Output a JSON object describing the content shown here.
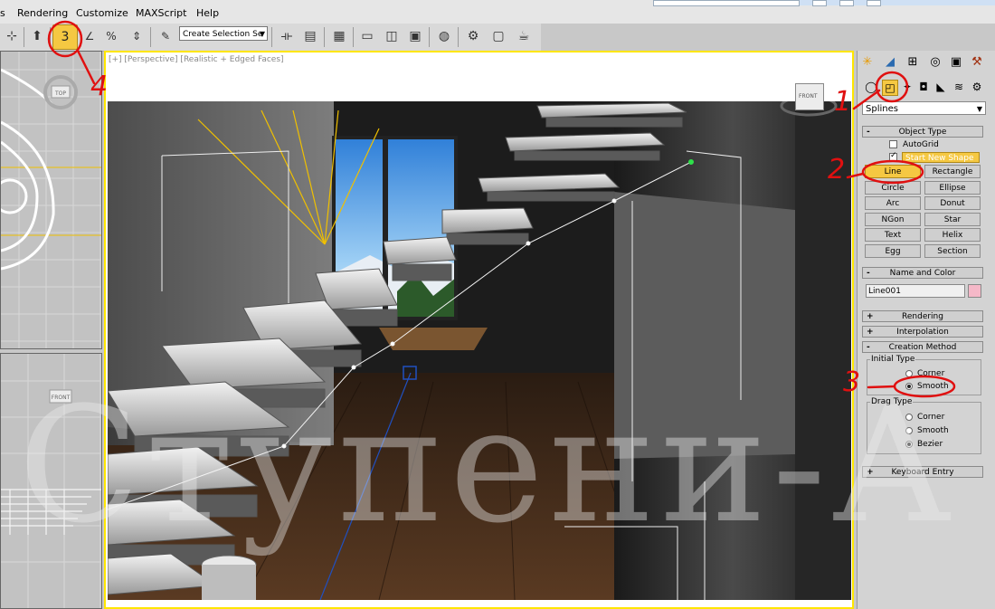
{
  "menu": {
    "items": [
      {
        "label": "s"
      },
      {
        "label": "Rendering"
      },
      {
        "label": "Customize"
      },
      {
        "label": "MAXScript"
      },
      {
        "label": "Help"
      }
    ]
  },
  "toolbar": {
    "snap_label": "3",
    "percent_snap_label": "%",
    "selection_set_placeholder": "Create Selection Se"
  },
  "viewport": {
    "label": "[+] [Perspective] [Realistic + Edged Faces]",
    "viewcube_top": "TOP",
    "viewcube_front": "FRONT",
    "viewcube_front_small": "FRONT"
  },
  "command_panel": {
    "category_dropdown": "Splines",
    "object_type": {
      "header": "Object Type",
      "autogrid_label": "AutoGrid",
      "autogrid_checked": false,
      "start_new_shape_label": "Start New Shape",
      "start_new_shape_checked": true,
      "buttons": [
        "Line",
        "Rectangle",
        "Circle",
        "Ellipse",
        "Arc",
        "Donut",
        "NGon",
        "Star",
        "Text",
        "Helix",
        "Egg",
        "Section"
      ],
      "active_button": "Line"
    },
    "name_and_color": {
      "header": "Name and Color",
      "name": "Line001",
      "color": "#f5b8c8"
    },
    "rendering_header": "Rendering",
    "interpolation_header": "Interpolation",
    "creation_method": {
      "header": "Creation Method",
      "initial_type_label": "Initial Type",
      "initial_options": [
        "Corner",
        "Smooth"
      ],
      "initial_selected": "Smooth",
      "drag_type_label": "Drag Type",
      "drag_options": [
        "Corner",
        "Smooth",
        "Bezier"
      ],
      "drag_selected": "Bezier"
    },
    "keyboard_entry_header": "Keyboard Entry"
  },
  "annotations": {
    "n1": "1",
    "n2": "2",
    "n3": "3",
    "n4": "4",
    "color": "#e01010"
  },
  "watermark": "Ступени-А",
  "colors": {
    "viewport_highlight": "#ffe600",
    "active_button": "#f5c842",
    "annotation": "#e01010"
  }
}
